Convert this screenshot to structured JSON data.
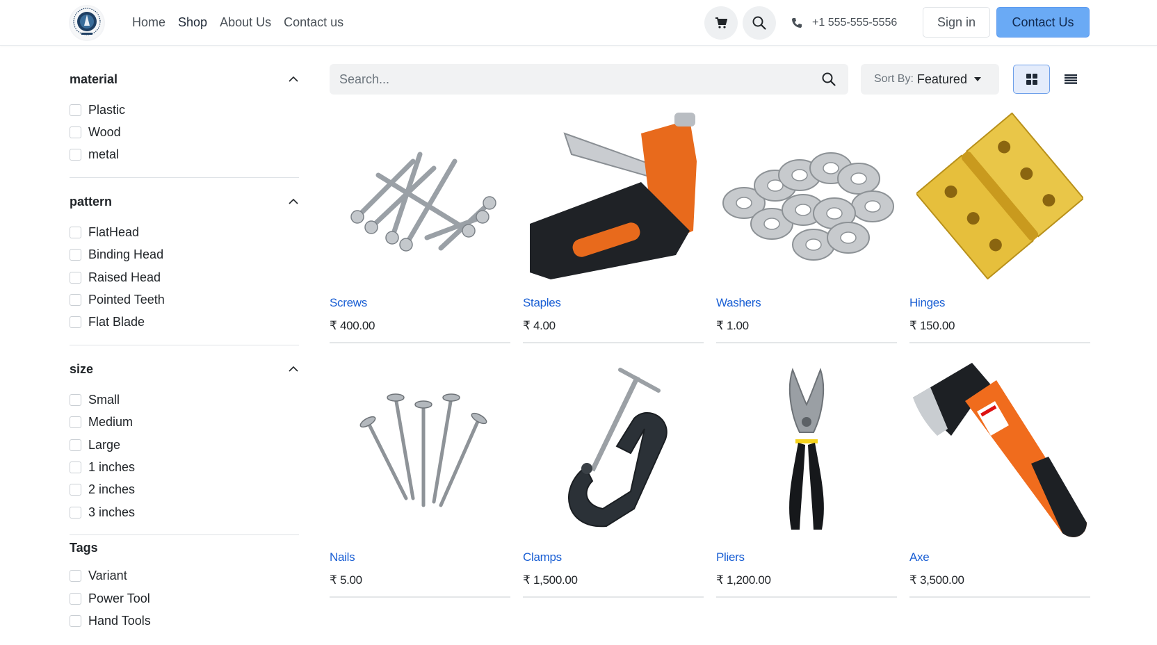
{
  "nav": {
    "links": [
      "Home",
      "Shop",
      "About Us",
      "Contact us"
    ],
    "active": "Shop",
    "phone": "+1 555-555-5556",
    "signin_label": "Sign in",
    "contact_label": "Contact Us",
    "cart_icon": "cart-icon",
    "search_icon": "search-icon",
    "phone_icon": "phone-icon"
  },
  "filters": [
    {
      "title": "material",
      "collapsible": true,
      "options": [
        "Plastic",
        "Wood",
        "metal"
      ]
    },
    {
      "title": "pattern",
      "collapsible": true,
      "options": [
        "FlatHead",
        "Binding Head",
        "Raised Head",
        "Pointed Teeth",
        "Flat Blade"
      ]
    },
    {
      "title": "size",
      "collapsible": true,
      "options": [
        "Small",
        "Medium",
        "Large",
        "1 inches",
        "2 inches",
        "3 inches"
      ]
    },
    {
      "title": "Tags",
      "collapsible": false,
      "options": [
        "Variant",
        "Power Tool",
        "Hand Tools"
      ]
    }
  ],
  "toolbar": {
    "search_placeholder": "Search...",
    "sort_label": "Sort By:",
    "sort_value": "Featured",
    "view_mode": "grid"
  },
  "products": [
    {
      "name": "Screws",
      "price": "₹ 400.00",
      "icon": "screws"
    },
    {
      "name": "Staples",
      "price": "₹ 4.00",
      "icon": "staple-gun"
    },
    {
      "name": "Washers",
      "price": "₹ 1.00",
      "icon": "washers"
    },
    {
      "name": "Hinges",
      "price": "₹ 150.00",
      "icon": "hinge"
    },
    {
      "name": "Nails",
      "price": "₹ 5.00",
      "icon": "nails"
    },
    {
      "name": "Clamps",
      "price": "₹ 1,500.00",
      "icon": "c-clamp"
    },
    {
      "name": "Pliers",
      "price": "₹ 1,200.00",
      "icon": "pliers"
    },
    {
      "name": "Axe",
      "price": "₹ 3,500.00",
      "icon": "axe"
    }
  ],
  "colors": {
    "accent": "#6aaaf5",
    "link": "#1a5fd4",
    "toolbar_bg": "#f1f2f3"
  }
}
